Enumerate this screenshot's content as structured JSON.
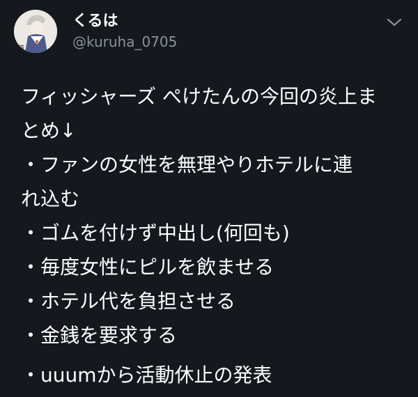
{
  "tweet": {
    "author": {
      "name": "くるは",
      "handle": "@kuruha_0705"
    },
    "lines": [
      "フィッシャーズ ぺけたんの今回の炎上ま",
      "とめ↓",
      "・ファンの女性を無理やりホテルに連",
      "れ込む",
      "・ゴムを付けず中出し(何回も)",
      "・毎度女性にピルを飲ませる",
      "・ホテル代を負担させる",
      "・金銭を要求する",
      "・uuumから活動休止の発表"
    ]
  },
  "icons": {
    "menu": "chevron-down-icon"
  },
  "colors": {
    "background": "#15181d",
    "text": "#ffffff",
    "secondary_text": "#8a939c"
  }
}
